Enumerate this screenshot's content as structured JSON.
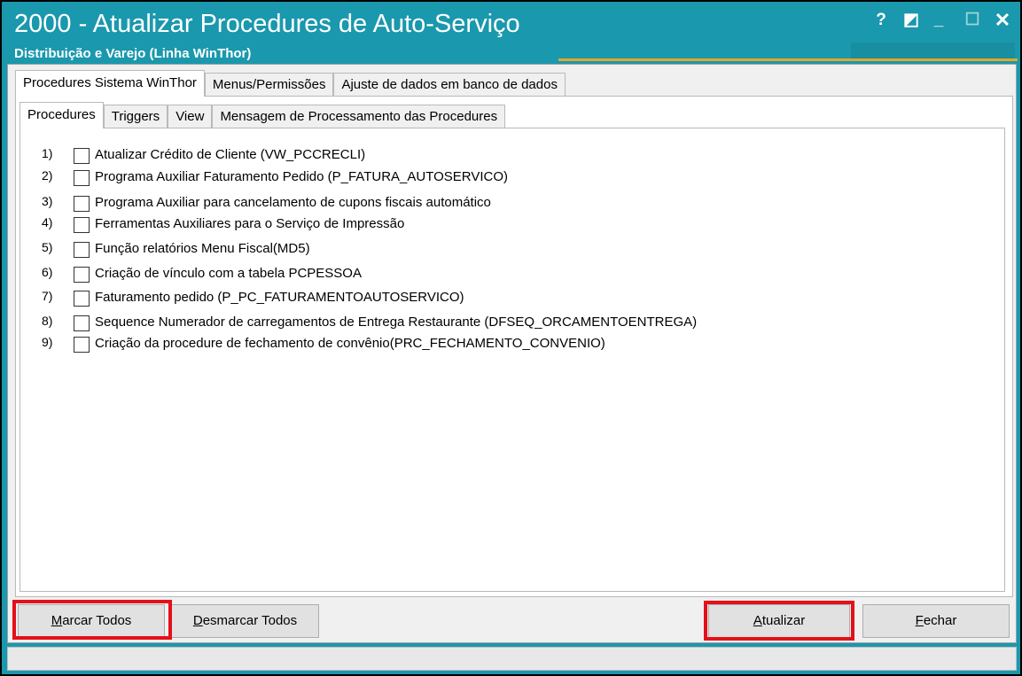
{
  "window": {
    "title": "2000 - Atualizar Procedures de Auto-Serviço",
    "subtitle": "Distribuição e Varejo (Linha WinThor)",
    "controls": {
      "help": "?",
      "theme": "◩",
      "minimize": "_",
      "maximize": "☐",
      "close": "✕"
    },
    "accent_color": "#1a98ad",
    "highlight_color": "#e4101a"
  },
  "outer_tabs": [
    {
      "label": "Procedures Sistema WinThor",
      "active": true
    },
    {
      "label": "Menus/Permissões",
      "active": false
    },
    {
      "label": "Ajuste de dados em banco de dados",
      "active": false
    }
  ],
  "inner_tabs": [
    {
      "label": "Procedures",
      "active": true
    },
    {
      "label": "Triggers",
      "active": false
    },
    {
      "label": "View",
      "active": false
    },
    {
      "label": "Mensagem de Processamento das Procedures",
      "active": false
    }
  ],
  "procedures": [
    {
      "num": "1)",
      "label": "Atualizar Crédito de Cliente (VW_PCCRECLI)",
      "checked": false
    },
    {
      "num": "2)",
      "label": "Programa Auxiliar Faturamento Pedido  (P_FATURA_AUTOSERVICO)",
      "checked": false
    },
    {
      "num": "3)",
      "label": "Programa Auxiliar para cancelamento de cupons fiscais automático",
      "checked": false
    },
    {
      "num": "4)",
      "label": "Ferramentas Auxiliares para o Serviço de Impressão",
      "checked": false
    },
    {
      "num": "5)",
      "label": "Função relatórios Menu Fiscal(MD5)",
      "checked": false
    },
    {
      "num": "6)",
      "label": "Criação de vínculo com a tabela PCPESSOA",
      "checked": false
    },
    {
      "num": "7)",
      "label": "Faturamento pedido (P_PC_FATURAMENTOAUTOSERVICO)",
      "checked": false
    },
    {
      "num": "8)",
      "label": "Sequence Numerador de carregamentos de Entrega Restaurante (DFSEQ_ORCAMENTOENTREGA)",
      "checked": false
    },
    {
      "num": "9)",
      "label": "Criação da procedure de fechamento de convênio(PRC_FECHAMENTO_CONVENIO)",
      "checked": false
    }
  ],
  "buttons": {
    "mark_all": {
      "mnemonic": "M",
      "rest": "arcar Todos"
    },
    "unmark_all": {
      "mnemonic": "D",
      "rest": "esmarcar Todos"
    },
    "update": {
      "mnemonic": "A",
      "rest": "tualizar"
    },
    "close": {
      "mnemonic": "F",
      "rest": "echar"
    }
  }
}
